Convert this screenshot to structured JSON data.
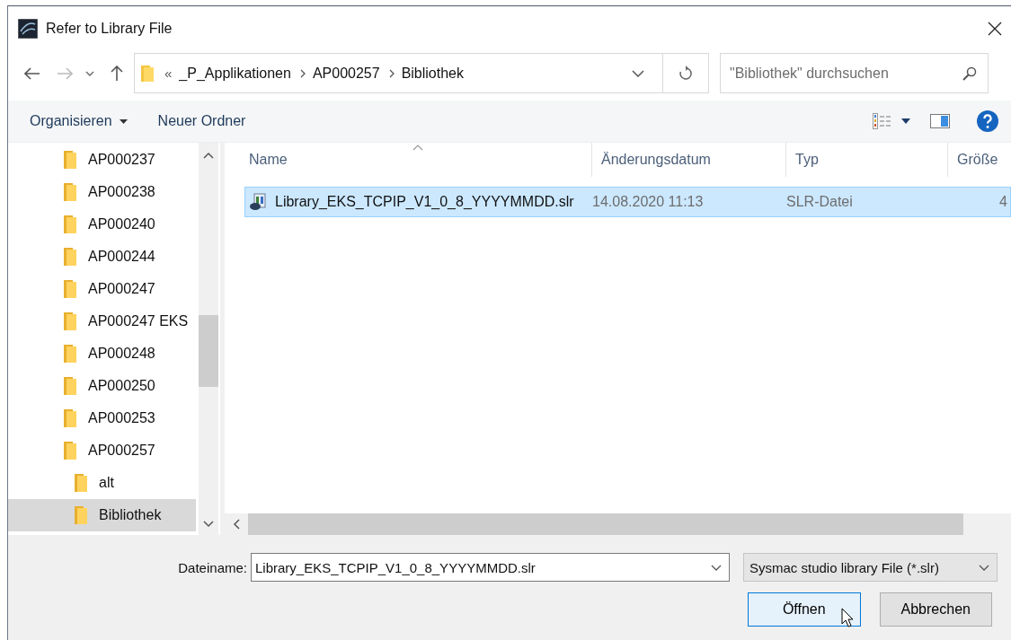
{
  "window": {
    "title": "Refer to Library File"
  },
  "navigation": {
    "overflow": "«",
    "path": [
      "_P_Applikationen",
      "AP000257",
      "Bibliothek"
    ]
  },
  "search": {
    "placeholder": "\"Bibliothek\" durchsuchen"
  },
  "toolbar": [
    {
      "kind": "menu",
      "label": "Organisieren"
    },
    {
      "kind": "button",
      "label": "Neuer Ordner"
    }
  ],
  "tree": [
    {
      "label": "AP000237",
      "selected": false
    },
    {
      "label": "AP000238",
      "selected": false
    },
    {
      "label": "AP000240",
      "selected": false
    },
    {
      "label": "AP000244",
      "selected": false
    },
    {
      "label": "AP000247",
      "selected": false
    },
    {
      "label": "AP000247 EKS",
      "selected": false
    },
    {
      "label": "AP000248",
      "selected": false
    },
    {
      "label": "AP000250",
      "selected": false
    },
    {
      "label": "AP000253",
      "selected": false
    },
    {
      "label": "AP000257",
      "selected": false,
      "children": [
        {
          "label": "alt",
          "selected": false
        },
        {
          "label": "Bibliothek",
          "selected": true
        }
      ]
    }
  ],
  "file_list": {
    "columns": [
      "Name",
      "Änderungsdatum",
      "Typ",
      "Größe"
    ],
    "rows": [
      {
        "name": "Library_EKS_TCPIP_V1_0_8_YYYYMMDD.slr",
        "date": "14.08.2020 11:13",
        "type": "SLR-Datei",
        "size": "4",
        "selected": true
      }
    ]
  },
  "file_name": {
    "label": "Dateiname:",
    "value": "Library_EKS_TCPIP_V1_0_8_YYYYMMDD.slr"
  },
  "file_type": {
    "value": "Sysmac studio library File (*.slr)"
  },
  "buttons": [
    {
      "label": "Öffnen",
      "focused": true
    },
    {
      "label": "Abbrechen",
      "focused": false
    }
  ]
}
